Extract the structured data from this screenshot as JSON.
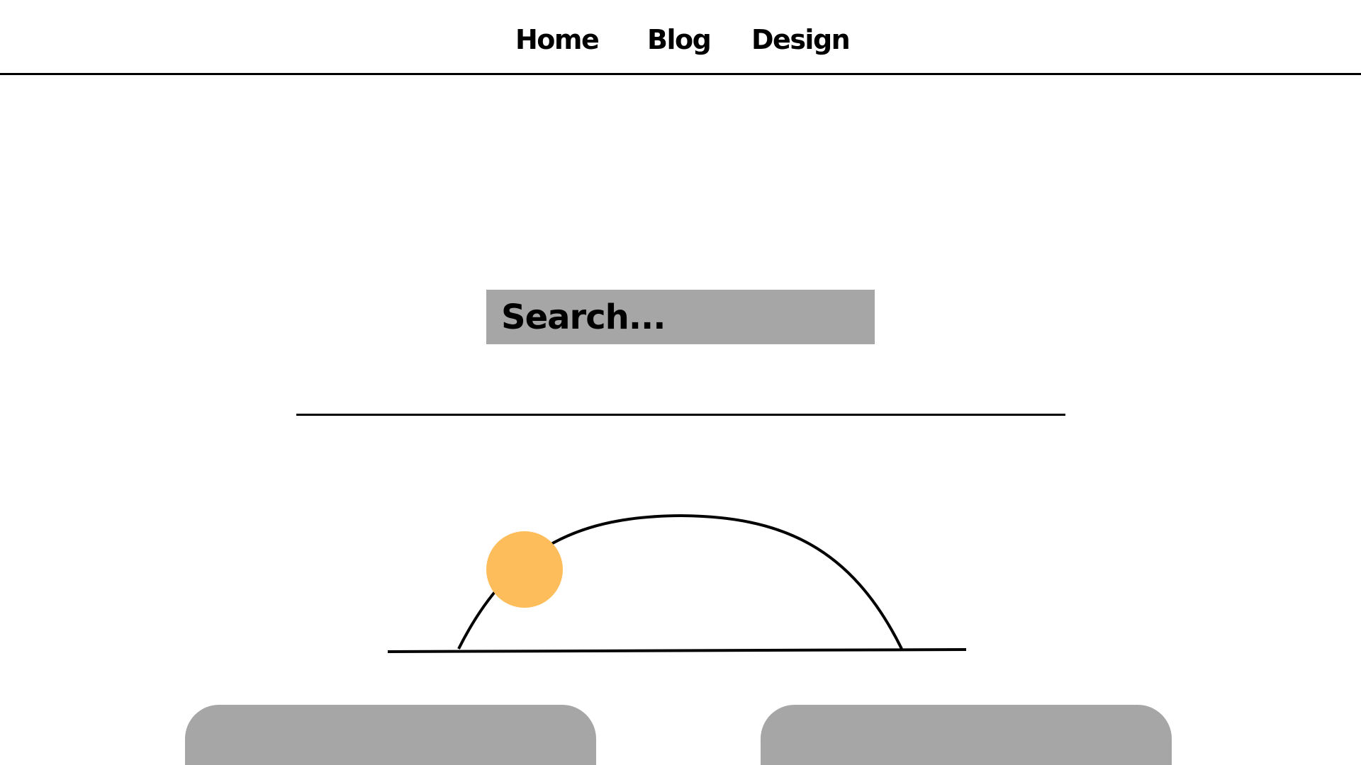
{
  "nav": {
    "items": [
      {
        "label": "Home"
      },
      {
        "label": "Blog"
      },
      {
        "label": "Design"
      }
    ]
  },
  "search": {
    "placeholder": "Search..."
  },
  "colors": {
    "sun": "#fdbd5b",
    "card": "#a6a6a6",
    "search_bg": "#a6a6a6",
    "line": "#000000"
  },
  "icons": {
    "sun": "sun-icon",
    "horizon": "horizon-arc-icon"
  }
}
